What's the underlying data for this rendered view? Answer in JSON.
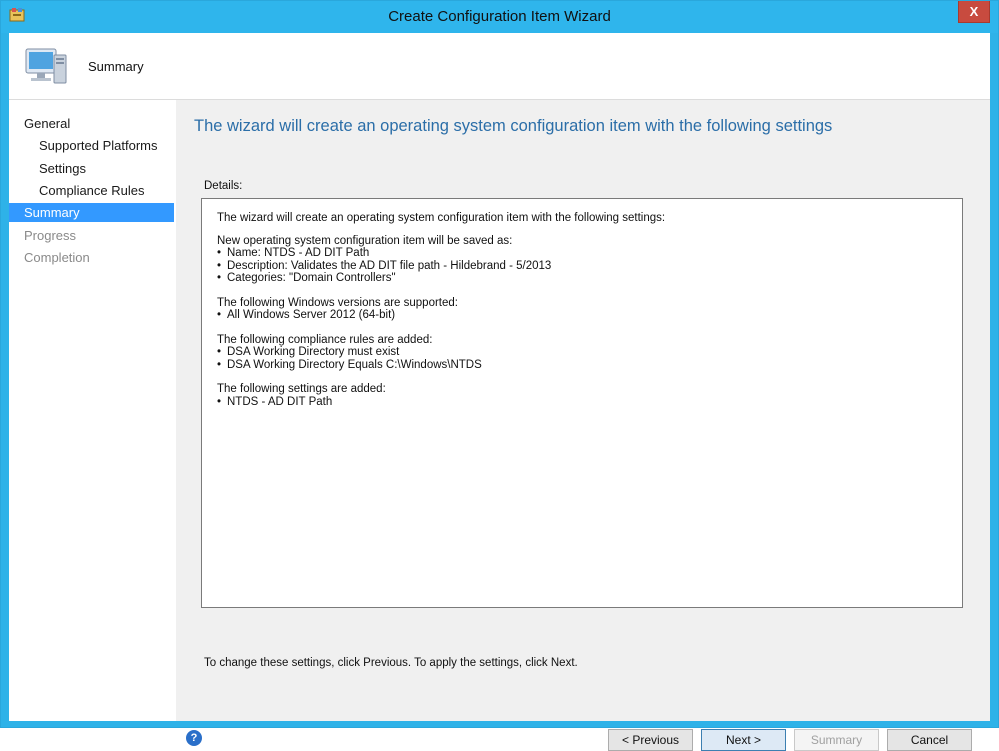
{
  "window": {
    "title": "Create Configuration Item Wizard",
    "close_label": "X",
    "accent_color": "#2eb2e8"
  },
  "header": {
    "title": "Summary",
    "icon": "computer-icon"
  },
  "nav": {
    "items": [
      {
        "label": "General",
        "state": "normal",
        "indent": 0
      },
      {
        "label": "Supported Platforms",
        "state": "normal",
        "indent": 1
      },
      {
        "label": "Settings",
        "state": "normal",
        "indent": 1
      },
      {
        "label": "Compliance Rules",
        "state": "normal",
        "indent": 1
      },
      {
        "label": "Summary",
        "state": "selected",
        "indent": 0
      },
      {
        "label": "Progress",
        "state": "disabled",
        "indent": 0
      },
      {
        "label": "Completion",
        "state": "disabled",
        "indent": 0
      }
    ]
  },
  "main": {
    "heading": "The wizard will create an operating system configuration item with the following settings",
    "details_label": "Details:",
    "details": {
      "intro": "The wizard will create an operating system configuration item with the following settings:",
      "groups": [
        {
          "title": "New operating system configuration item will be saved as:",
          "items": [
            "Name: NTDS - AD DIT Path",
            "Description: Validates the AD DIT file path - Hildebrand - 5/2013",
            "Categories: \"Domain Controllers\""
          ]
        },
        {
          "title": "The following Windows versions are supported:",
          "items": [
            "All Windows Server 2012 (64-bit)"
          ]
        },
        {
          "title": "The following compliance rules are added:",
          "items": [
            "DSA Working Directory must exist",
            "DSA Working Directory Equals C:\\Windows\\NTDS"
          ]
        },
        {
          "title": "The following settings are added:",
          "items": [
            "NTDS - AD DIT Path"
          ]
        }
      ]
    },
    "footer_note": "To change these settings, click Previous. To apply the settings, click Next."
  },
  "buttons": {
    "help": "?",
    "previous": "< Previous",
    "next": "Next >",
    "summary": "Summary",
    "cancel": "Cancel"
  }
}
